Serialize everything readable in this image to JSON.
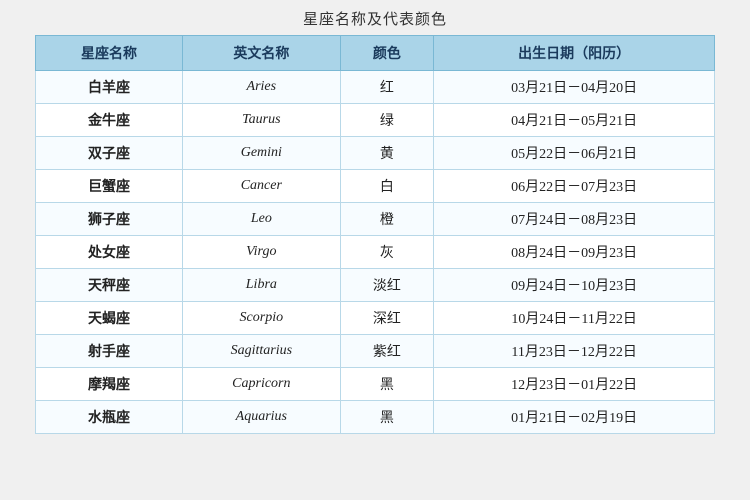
{
  "title": "星座名称及代表颜色",
  "headers": [
    "星座名称",
    "英文名称",
    "颜色",
    "出生日期（阳历）"
  ],
  "rows": [
    {
      "chinese": "白羊座",
      "english": "Aries",
      "color": "红",
      "dates": "03月21日－04月20日"
    },
    {
      "chinese": "金牛座",
      "english": "Taurus",
      "color": "绿",
      "dates": "04月21日－05月21日"
    },
    {
      "chinese": "双子座",
      "english": "Gemini",
      "color": "黄",
      "dates": "05月22日－06月21日"
    },
    {
      "chinese": "巨蟹座",
      "english": "Cancer",
      "color": "白",
      "dates": "06月22日－07月23日"
    },
    {
      "chinese": "狮子座",
      "english": "Leo",
      "color": "橙",
      "dates": "07月24日－08月23日"
    },
    {
      "chinese": "处女座",
      "english": "Virgo",
      "color": "灰",
      "dates": "08月24日－09月23日"
    },
    {
      "chinese": "天秤座",
      "english": "Libra",
      "color": "淡红",
      "dates": "09月24日－10月23日"
    },
    {
      "chinese": "天蝎座",
      "english": "Scorpio",
      "color": "深红",
      "dates": "10月24日－11月22日"
    },
    {
      "chinese": "射手座",
      "english": "Sagittarius",
      "color": "紫红",
      "dates": "11月23日－12月22日"
    },
    {
      "chinese": "摩羯座",
      "english": "Capricorn",
      "color": "黑",
      "dates": "12月23日－01月22日"
    },
    {
      "chinese": "水瓶座",
      "english": "Aquarius",
      "color": "黑",
      "dates": "01月21日－02月19日"
    }
  ]
}
